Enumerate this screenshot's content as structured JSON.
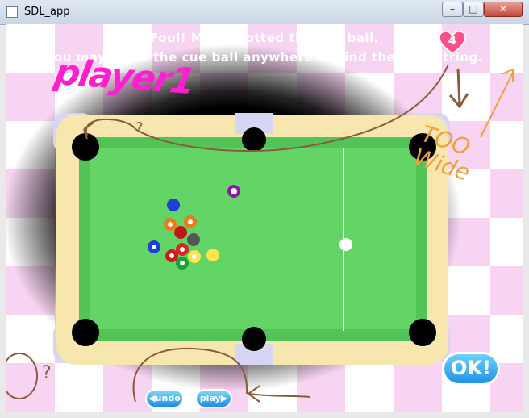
{
  "window": {
    "title": "SDL_app",
    "minimize_glyph": "–",
    "maximize_glyph": "□",
    "close_glyph": "✕"
  },
  "game": {
    "message_line1": "Foul! Marin potted the cue ball.",
    "message_line2": "You may place the cue ball anywhere behind the headstring.",
    "shot_counter": "4",
    "heart_color": "#ff4f8a",
    "ok_label": "OK!",
    "undo_label": "◀undo",
    "play_label": "play▶",
    "felt_color": "#62d566",
    "rail_color": "#f7e6ad",
    "cloth_cushion_color": "#52c457"
  },
  "annotations": {
    "player_label": "player1",
    "too_wide": "TOO Wide",
    "question_top": "?",
    "question_bottom": "?",
    "handwriting_brown": "#8b5a3c",
    "handwriting_orange": "#f0a040",
    "handwriting_magenta": "#ff1fd0"
  },
  "balls": [
    {
      "name": "cue-ball",
      "color": "#ffffff"
    },
    {
      "name": "ball-2",
      "color": "#1d3fd6"
    },
    {
      "name": "ball-10",
      "color": "#1d3fd6",
      "stripe": true
    },
    {
      "name": "ball-12",
      "color": "#8a1ba8",
      "stripe": true
    },
    {
      "name": "ball-5",
      "color": "#f07a1a"
    },
    {
      "name": "ball-13",
      "color": "#f07a1a",
      "stripe": true
    },
    {
      "name": "ball-7",
      "color": "#c01818"
    },
    {
      "name": "ball-8",
      "color": "#555555"
    },
    {
      "name": "ball-3",
      "color": "#dd2222"
    },
    {
      "name": "ball-11",
      "color": "#cc1a1a",
      "stripe": true
    },
    {
      "name": "ball-1",
      "color": "#ffe34a"
    },
    {
      "name": "ball-9",
      "color": "#ffe34a",
      "stripe": true
    },
    {
      "name": "ball-6",
      "color": "#19a23a"
    },
    {
      "name": "ball-15",
      "color": "#b21c1c",
      "stripe": true
    }
  ]
}
